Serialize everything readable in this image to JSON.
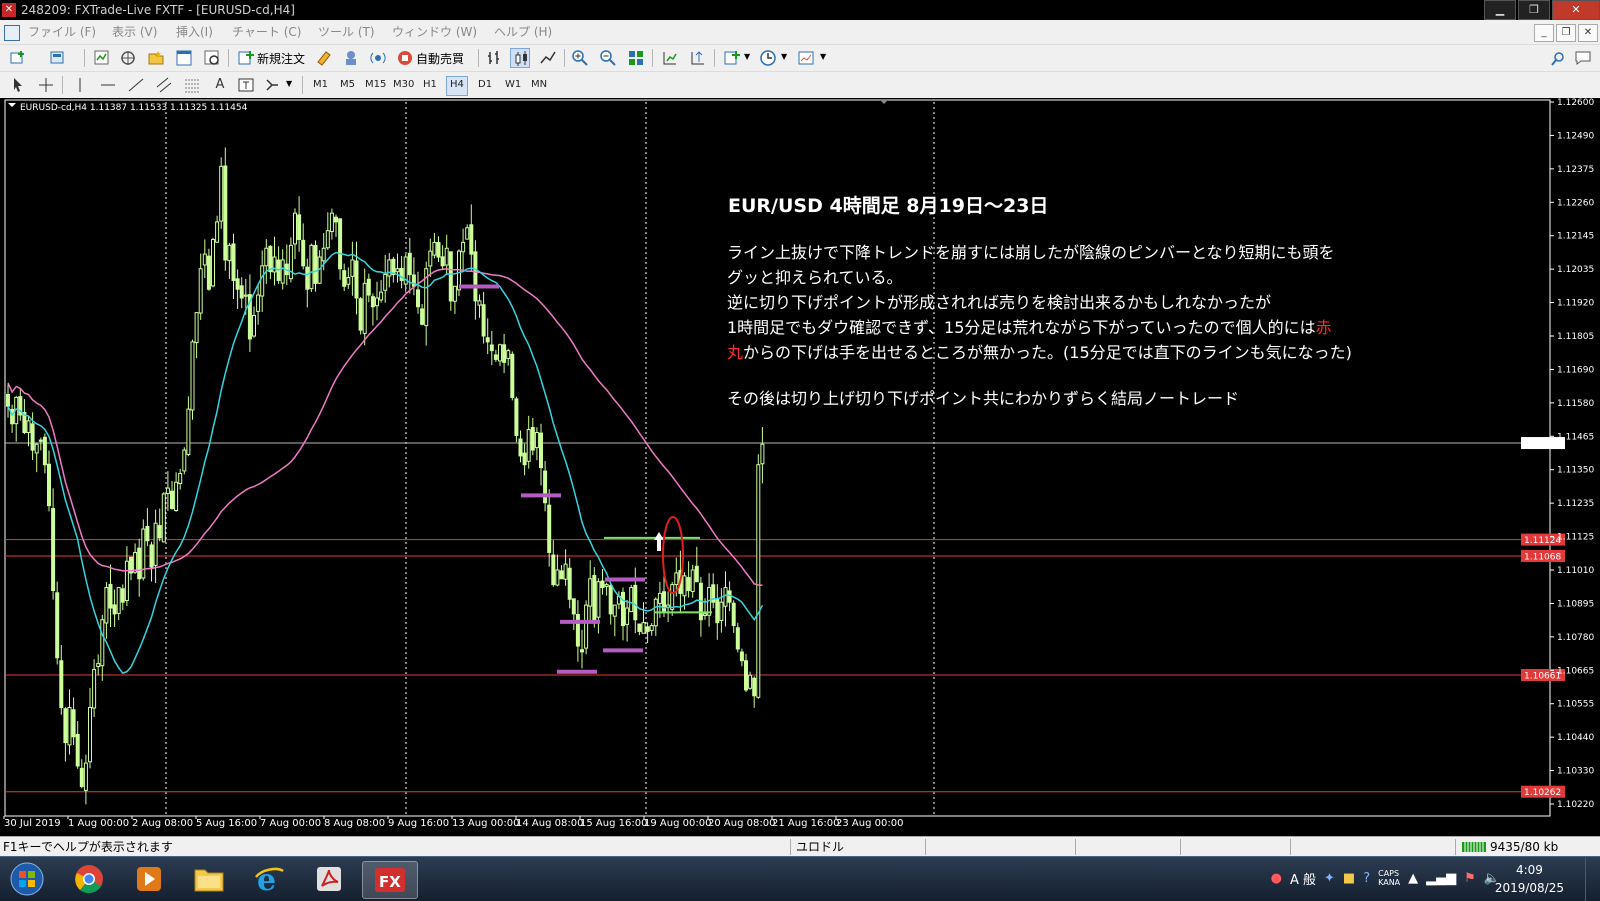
{
  "window": {
    "title": "248209: FXTrade-Live FXTF - [EURUSD-cd,H4]",
    "buttons": {
      "minimize": "▁",
      "restore": "❐",
      "close": "✕"
    }
  },
  "menu": [
    "ファイル (F)",
    "表示 (V)",
    "挿入(I)",
    "チャート (C)",
    "ツール (T)",
    "ウィンドウ (W)",
    "ヘルプ (H)"
  ],
  "toolbar": {
    "new_order": "新規注文",
    "auto_trade": "自動売買",
    "timeframes": [
      "M1",
      "M5",
      "M15",
      "M30",
      "H1",
      "H4",
      "D1",
      "W1",
      "MN"
    ],
    "active_timeframe": "H4"
  },
  "chart_header": "EURUSD-cd,H4  1.11387 1.11533 1.11325 1.11454",
  "annotation": {
    "title": "EUR/USD 4時間足  8月19日～23日",
    "line1": "ライン上抜けで下降トレンドを崩すには崩したが陰線のピンバーとなり短期にも頭を",
    "line2": "グッと抑えられている。",
    "line3": "逆に切り下げポイントが形成されれば売りを検討出来るかもしれなかったが",
    "line4a": "1時間足でもダウ確認できず、15分足は荒れながら下がっていったので個人的には",
    "line4b": "赤",
    "line5a": "丸",
    "line5b": "からの下げは手を出せるところが無かった。(15分足では直下のラインも気になった)",
    "line6": "その後は切り上げ切り下げポイント共にわかりずらく結局ノートレード"
  },
  "status": {
    "help": "F1キーでヘルプが表示されます",
    "profile": "ユロドル",
    "traffic": "9435/80 kb"
  },
  "clock": {
    "time": "4:09",
    "date": "2019/08/25"
  },
  "tray": {
    "lang": "A 般",
    "caps": "CAPS",
    "kana": "KANA"
  },
  "colors": {
    "bull": "#ccff99",
    "bear": "#ccff99",
    "ma_fast": "#33d6e0",
    "ma_slow": "#f07ac8",
    "hline": "#e23a3a",
    "marker": "#b45cc4",
    "circle": "#e02020",
    "grid": "#ffffff"
  },
  "chart_data": {
    "type": "candlestick",
    "symbol": "EURUSD-cd",
    "timeframe": "H4",
    "ohlc_header": [
      1.11387,
      1.11533,
      1.11325,
      1.11454
    ],
    "ylim": [
      1.1022,
      1.1262
    ],
    "y_ticks": [
      "1.12600",
      "1.12490",
      "1.12375",
      "1.12260",
      "1.12145",
      "1.12035",
      "1.11920",
      "1.11805",
      "1.11690",
      "1.11580",
      "1.11465",
      "1.11350",
      "1.11235",
      "1.11125",
      "1.11010",
      "1.10895",
      "1.10780",
      "1.10665",
      "1.10555",
      "1.10440",
      "1.10330",
      "1.10220"
    ],
    "x_ticks": [
      "30 Jul 2019",
      "1 Aug 00:00",
      "2 Aug 08:00",
      "5 Aug 16:00",
      "7 Aug 00:00",
      "8 Aug 08:00",
      "9 Aug 16:00",
      "13 Aug 00:00",
      "14 Aug 08:00",
      "15 Aug 16:00",
      "19 Aug 00:00",
      "20 Aug 08:00",
      "21 Aug 16:00",
      "23 Aug 00:00"
    ],
    "price_levels": [
      {
        "label": "1.11454",
        "value": 1.11454,
        "kind": "current"
      },
      {
        "label": "1.11124",
        "value": 1.11124,
        "kind": "line"
      },
      {
        "label": "1.11068",
        "value": 1.11068,
        "kind": "line"
      },
      {
        "label": "1.10661",
        "value": 1.10661,
        "kind": "line"
      },
      {
        "label": "1.10262",
        "value": 1.10262,
        "kind": "line"
      }
    ],
    "close": [
      1.1158,
      1.1152,
      1.1161,
      1.1155,
      1.1149,
      1.1153,
      1.1143,
      1.1145,
      1.1146,
      1.1138,
      1.1124,
      1.1095,
      1.1072,
      1.1055,
      1.1043,
      1.1055,
      1.1045,
      1.1035,
      1.1028,
      1.1036,
      1.1055,
      1.1068,
      1.107,
      1.1085,
      1.1096,
      1.1089,
      1.1087,
      1.1096,
      1.1091,
      1.1105,
      1.1101,
      1.1108,
      1.1099,
      1.1116,
      1.1112,
      1.1103,
      1.1118,
      1.1113,
      1.1128,
      1.113,
      1.1123,
      1.1132,
      1.1135,
      1.1143,
      1.1157,
      1.118,
      1.119,
      1.1205,
      1.121,
      1.1198,
      1.1215,
      1.1221,
      1.124,
      1.1208,
      1.1213,
      1.1201,
      1.1198,
      1.1195,
      1.1196,
      1.1181,
      1.1189,
      1.1196,
      1.1206,
      1.1212,
      1.1204,
      1.1209,
      1.1201,
      1.1208,
      1.1203,
      1.1213,
      1.1224,
      1.1215,
      1.1206,
      1.1198,
      1.1213,
      1.12,
      1.1209,
      1.1212,
      1.1218,
      1.1224,
      1.1221,
      1.1205,
      1.1199,
      1.1202,
      1.1208,
      1.1195,
      1.1184,
      1.12,
      1.1196,
      1.1192,
      1.1195,
      1.1197,
      1.1203,
      1.1208,
      1.1203,
      1.1205,
      1.1201,
      1.1209,
      1.1203,
      1.1199,
      1.1192,
      1.1186,
      1.1205,
      1.1211,
      1.1214,
      1.1209,
      1.1206,
      1.1212,
      1.1194,
      1.1199,
      1.1211,
      1.1214,
      1.1219,
      1.121,
      1.1194,
      1.1194,
      1.1182,
      1.118,
      1.1177,
      1.1174,
      1.1179,
      1.1173,
      1.1177,
      1.1161,
      1.1148,
      1.1141,
      1.1138,
      1.115,
      1.1143,
      1.1149,
      1.1137,
      1.1125,
      1.1108,
      1.1097,
      1.1102,
      1.1099,
      1.1104,
      1.1092,
      1.1087,
      1.1076,
      1.1074,
      1.109,
      1.1099,
      1.1085,
      1.1098,
      1.1096,
      1.1097,
      1.1087,
      1.109,
      1.1093,
      1.1083,
      1.1089,
      1.1096,
      1.1085,
      1.1081,
      1.1084,
      1.1081,
      1.1083,
      1.1092,
      1.1094,
      1.1088,
      1.109,
      1.1097,
      1.1101,
      1.1094,
      1.11,
      1.1095,
      1.1102,
      1.1098,
      1.1085,
      1.1087,
      1.1096,
      1.1091,
      1.1084,
      1.1091,
      1.1096,
      1.1091,
      1.1083,
      1.1075,
      1.1071,
      1.1061,
      1.1066,
      1.1059,
      1.1138,
      1.1145
    ]
  }
}
